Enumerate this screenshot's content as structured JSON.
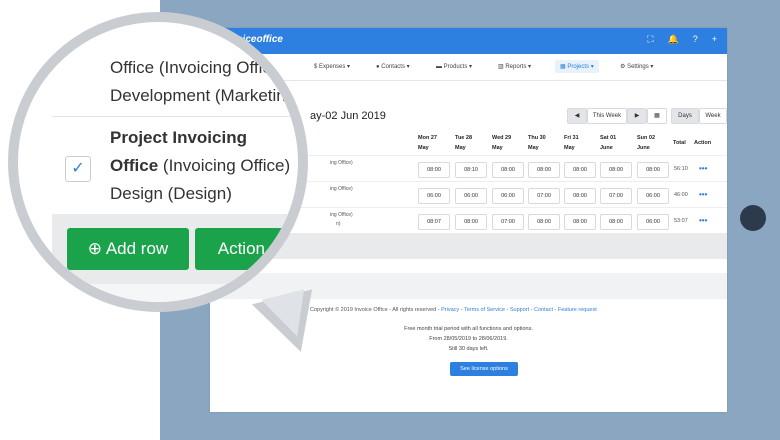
{
  "app": {
    "brand": "invoiceoffice",
    "topbar_icons": [
      "expand-icon",
      "bell-icon",
      "help-icon",
      "plus-icon"
    ],
    "nav": [
      {
        "label": "Expenses",
        "icon": "dollar-icon",
        "caret": "▾"
      },
      {
        "label": "Contacts",
        "icon": "user-icon",
        "caret": "▾"
      },
      {
        "label": "Products",
        "icon": "truck-icon",
        "caret": "▾"
      },
      {
        "label": "Reports",
        "icon": "chart-icon",
        "caret": "▾"
      },
      {
        "label": "Projects",
        "icon": "calendar-icon",
        "caret": "▾",
        "active": true
      },
      {
        "label": "Settings",
        "icon": "gear-icon",
        "caret": "▾"
      }
    ]
  },
  "timesheet": {
    "date_range": "ay-02 Jun 2019",
    "controls": {
      "prev": "◀",
      "this_week": "This Week",
      "next": "▶",
      "calendar": "▦",
      "days": "Days",
      "week": "Week"
    },
    "columns": [
      {
        "line1": "Mon 27",
        "line2": "May"
      },
      {
        "line1": "Tue 28",
        "line2": "May"
      },
      {
        "line1": "Wed 29",
        "line2": "May"
      },
      {
        "line1": "Thu 30",
        "line2": "May"
      },
      {
        "line1": "Fri 31",
        "line2": "May"
      },
      {
        "line1": "Sat 01",
        "line2": "June"
      },
      {
        "line1": "Sun 02",
        "line2": "June"
      }
    ],
    "total_header": "Total",
    "action_header": "Action",
    "rows": [
      {
        "label": "ing Office)",
        "cells": [
          "08:00",
          "08:10",
          "08:00",
          "08:00",
          "08:00",
          "08:00",
          "08:00"
        ],
        "total": "56:10"
      },
      {
        "label": "ing Office)",
        "cells": [
          "06:00",
          "06:00",
          "06:00",
          "07:00",
          "08:00",
          "07:00",
          "06:00"
        ],
        "total": "46:00"
      },
      {
        "label": "ing Office)",
        "label2": "n)",
        "cells": [
          "08:07",
          "08:00",
          "07:00",
          "08:00",
          "08:00",
          "08:00",
          "06:00"
        ],
        "total": "53:07"
      }
    ],
    "action_icon": "•••"
  },
  "footer": {
    "copyright": "Copyright © 2019 Invoice Office - All rights reserved -",
    "links": [
      "Privacy",
      "Terms of Service",
      "Support",
      "Contact",
      "Feature request"
    ],
    "separator": "-",
    "trial_line1": "Free month trial period with all functions and options.",
    "trial_line2": "From 28/05/2019 to 28/06/2019.",
    "trial_line3": "Still 30 days left.",
    "license_button": "See license options"
  },
  "magnifier": {
    "line1_prefix": "Office",
    "line1_rest": " (Invoicing Offic",
    "line2": "Development (Marketing",
    "project_title": "Project Invoicing",
    "project_line2_bold": "Office",
    "project_line2_rest": " (Invoicing Office)",
    "project_line3": "Design (Design)",
    "check": "✓",
    "add_row_label": "Add row",
    "add_row_icon": "⊕",
    "action_label": "Action",
    "action_caret": "▾"
  }
}
